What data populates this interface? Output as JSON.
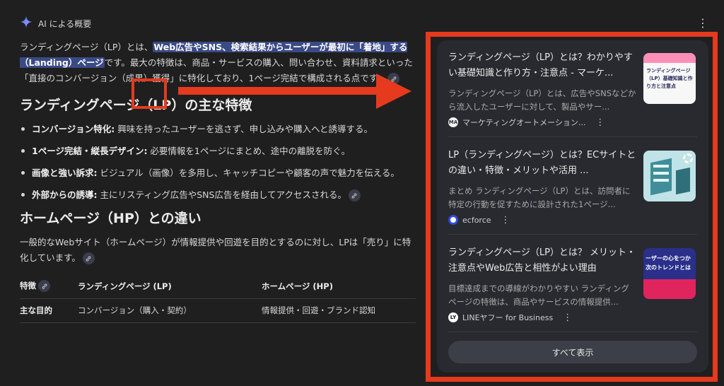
{
  "overview": {
    "header_label": "AI による概要",
    "intro_parts": {
      "p1": "ランディングページ（LP）とは、",
      "highlight": "Web広告やSNS、検索結果からユーザーが最初に「着地」する（Landing）ページ",
      "p2": "です。最大の特徴は、商品・サービスの購入、問い合わせ、資料請求といった「直接のコンバージョン（成果）獲得」に特化しており、1ページ完結で構成される点です。"
    },
    "section1": {
      "heading": "ランディングページ（LP）の主な特徴",
      "items": [
        {
          "bold": "コンバージョン特化:",
          "text": " 興味を持ったユーザーを逃さず、申し込みや購入へと誘導する。"
        },
        {
          "bold": "1ページ完結・縦長デザイン:",
          "text": " 必要情報を1ページにまとめ、途中の離脱を防ぐ。"
        },
        {
          "bold": "画像と強い訴求:",
          "text": " ビジュアル（画像）を多用し、キャッチコピーや顧客の声で魅力を伝える。"
        },
        {
          "bold": "外部からの誘導:",
          "text": " 主にリスティング広告やSNS広告を経由してアクセスされる。"
        }
      ]
    },
    "section2": {
      "heading": "ホームページ（HP）との違い",
      "text": "一般的なWebサイト（ホームページ）が情報提供や回遊を目的とするのに対し、LPは「売り」に特化しています。"
    },
    "table": {
      "headers": [
        "特徴",
        "ランディングページ (LP)",
        "ホームページ (HP)"
      ],
      "rows": [
        [
          "主な目的",
          "コンバージョン（購入・契約）",
          "情報提供・回遊・ブランド認知"
        ]
      ]
    }
  },
  "sources": {
    "cards": [
      {
        "title": "ランディングページ（LP）とは？わかりやすい基礎知識と作り方・注意点 - マーケ...",
        "snippet": "ランディングページ（LP）とは、広告やSNSなどから流入したユーザーに対して、製品やサー...",
        "site": "マーケティングオートメーション...",
        "favicon_text": "MA",
        "thumb_text": "ランディングページ（LP）基礎知識と作り方と注意点"
      },
      {
        "title": "LP（ランディングページ）とは？ECサイトとの違い・特徴・メリットや活用 ...",
        "snippet": "まとめ ランディングページ（LP）とは、訪問者に特定の行動を促すために設計された1ページ...",
        "site": "ecforce",
        "favicon_text": "",
        "thumb_text": ""
      },
      {
        "title": "ランディングページ（LP）とは？ メリット・注意点やWeb広告と相性がよい理由",
        "snippet": "目標達成までの導線がわかりやすい ランディングページの特徴は、商品やサービスの情報提供...",
        "site": "LINEヤフー for Business",
        "favicon_text": "LY",
        "thumb_text": "ーザーの心をつか次のトレンドとは"
      }
    ],
    "show_all_label": "すべて表示"
  },
  "colors": {
    "background": "#1f1f1f",
    "panel": "#282a2f",
    "highlight": "#3a4a86",
    "annotation_red": "#e53a1e"
  }
}
